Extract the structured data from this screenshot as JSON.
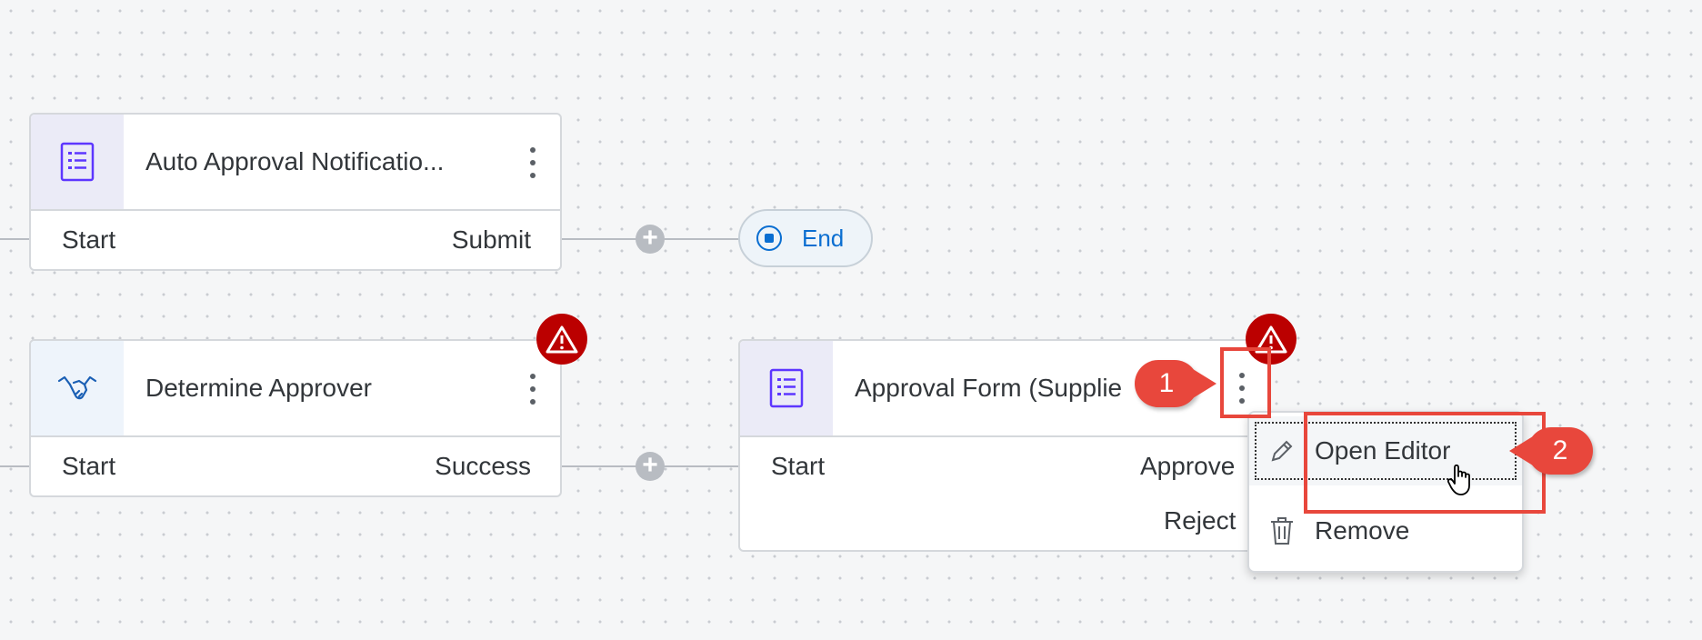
{
  "nodes": [
    {
      "title": "Auto Approval Notificatio...",
      "icon": "form-icon",
      "ports_left": [
        "Start"
      ],
      "ports_right": [
        "Submit"
      ]
    },
    {
      "title": "Determine Approver",
      "icon": "handshake-icon",
      "ports_left": [
        "Start"
      ],
      "ports_right": [
        "Success"
      ]
    },
    {
      "title": "Approval Form (Supplie",
      "icon": "form-icon",
      "ports_left": [
        "Start"
      ],
      "ports_right": [
        "Approve",
        "Reject"
      ]
    }
  ],
  "end_node": {
    "label": "End"
  },
  "context_menu": {
    "items": [
      {
        "label": "Open Editor",
        "icon": "pencil-icon"
      },
      {
        "label": "Remove",
        "icon": "trash-icon"
      }
    ]
  },
  "annotations": {
    "step1": "1",
    "step2": "2"
  },
  "colors": {
    "accent": "#0a6ed1",
    "warning": "#bb0000",
    "annotation": "#e8473c",
    "icon": "#5d36ff"
  }
}
